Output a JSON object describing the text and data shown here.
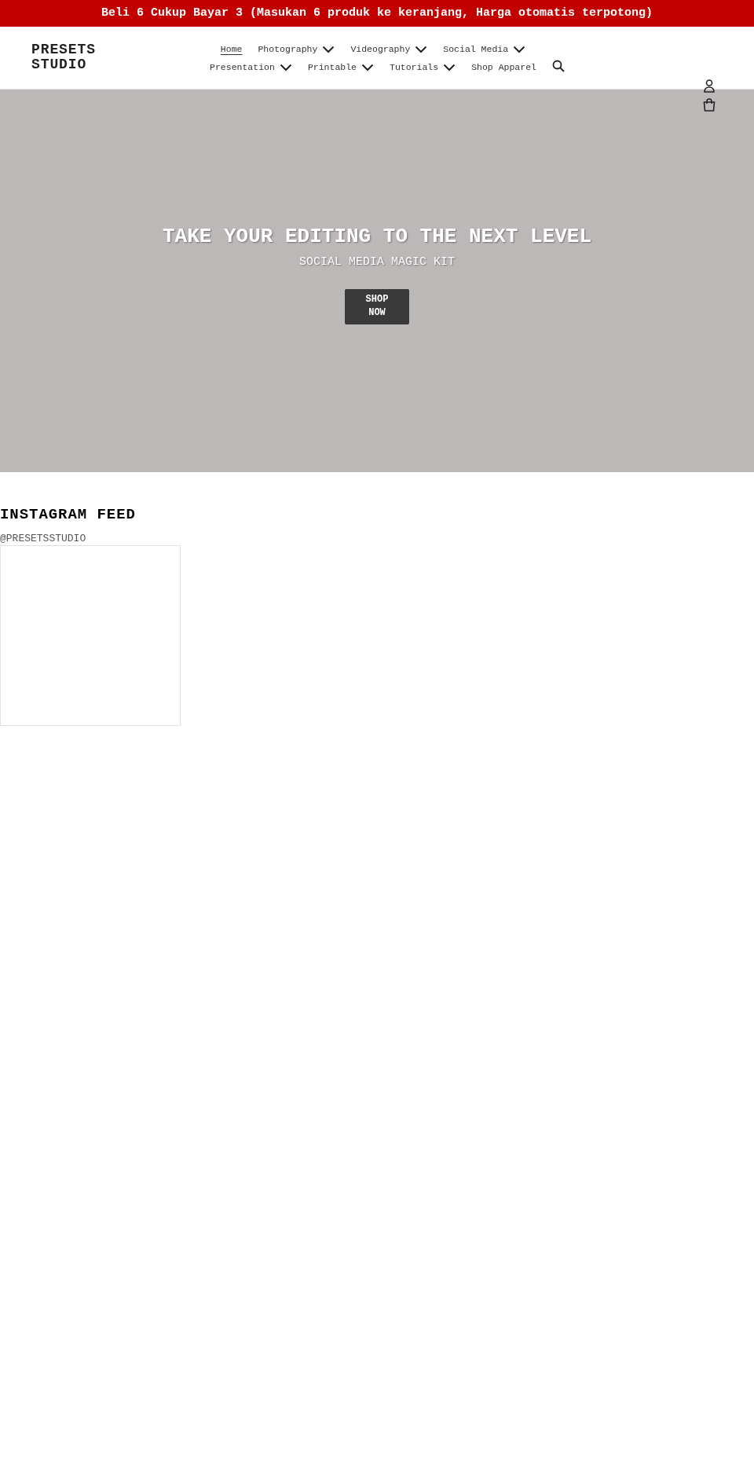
{
  "announcement": "Beli 6 Cukup Bayar 3 (Masukan 6 produk ke keranjang, Harga otomatis terpotong)",
  "logo": "PRESETS STUDIO",
  "nav": [
    {
      "label": "Home",
      "selected": true,
      "dropdown": false
    },
    {
      "label": "Photography",
      "selected": false,
      "dropdown": true
    },
    {
      "label": "Videography",
      "selected": false,
      "dropdown": true
    },
    {
      "label": "Social Media",
      "selected": false,
      "dropdown": true
    },
    {
      "label": "Presentation",
      "selected": false,
      "dropdown": true
    },
    {
      "label": "Printable",
      "selected": false,
      "dropdown": true
    },
    {
      "label": "Tutorials",
      "selected": false,
      "dropdown": true
    },
    {
      "label": "Shop Apparel",
      "selected": false,
      "dropdown": false
    }
  ],
  "hero": {
    "title": "TAKE YOUR EDITING TO THE NEXT LEVEL",
    "subtitle": "SOCIAL MEDIA MAGIC KIT",
    "button": "SHOP NOW"
  },
  "instagram": {
    "title": "INSTAGRAM FEED",
    "handle": "@PRESETSSTUDIO"
  }
}
